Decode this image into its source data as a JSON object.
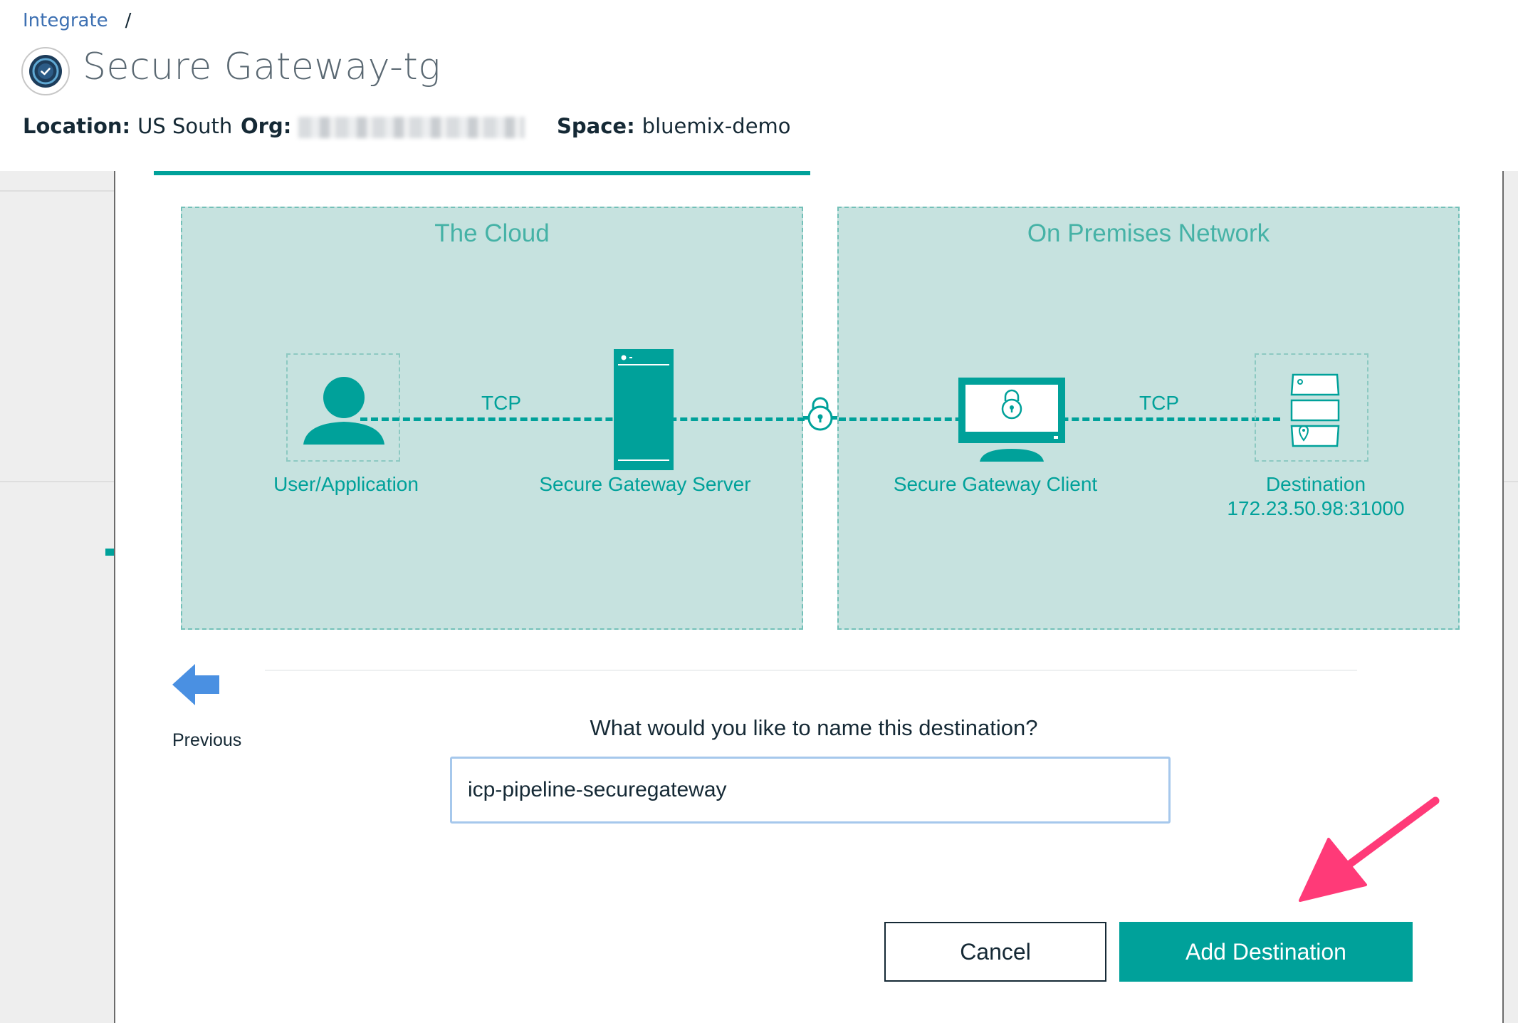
{
  "breadcrumb": {
    "parent": "Integrate",
    "separator": "/"
  },
  "service": {
    "title": "Secure Gateway-tg",
    "icon": "secure-gateway-icon"
  },
  "meta": {
    "location_label": "Location:",
    "location_value": "US South",
    "org_label": "Org:",
    "space_label": "Space:",
    "space_value": "bluemix-demo"
  },
  "diagram": {
    "cloud_zone_title": "The Cloud",
    "premises_zone_title": "On Premises Network",
    "user_label": "User/Application",
    "server_label": "Secure Gateway Server",
    "client_label": "Secure Gateway Client",
    "destination_label": "Destination",
    "destination_address": "172.23.50.98:31000",
    "protocol_left": "TCP",
    "protocol_right": "TCP"
  },
  "wizard": {
    "previous_label": "Previous",
    "question": "What would you like to name this destination?",
    "destination_name_value": "icp-pipeline-securegateway",
    "cancel_label": "Cancel",
    "add_label": "Add Destination"
  },
  "colors": {
    "accent": "#00a19a",
    "zone_fill": "#c6e2df",
    "link": "#3d70b2",
    "back_arrow": "#4a90e2",
    "callout_arrow": "#ff3a78"
  }
}
